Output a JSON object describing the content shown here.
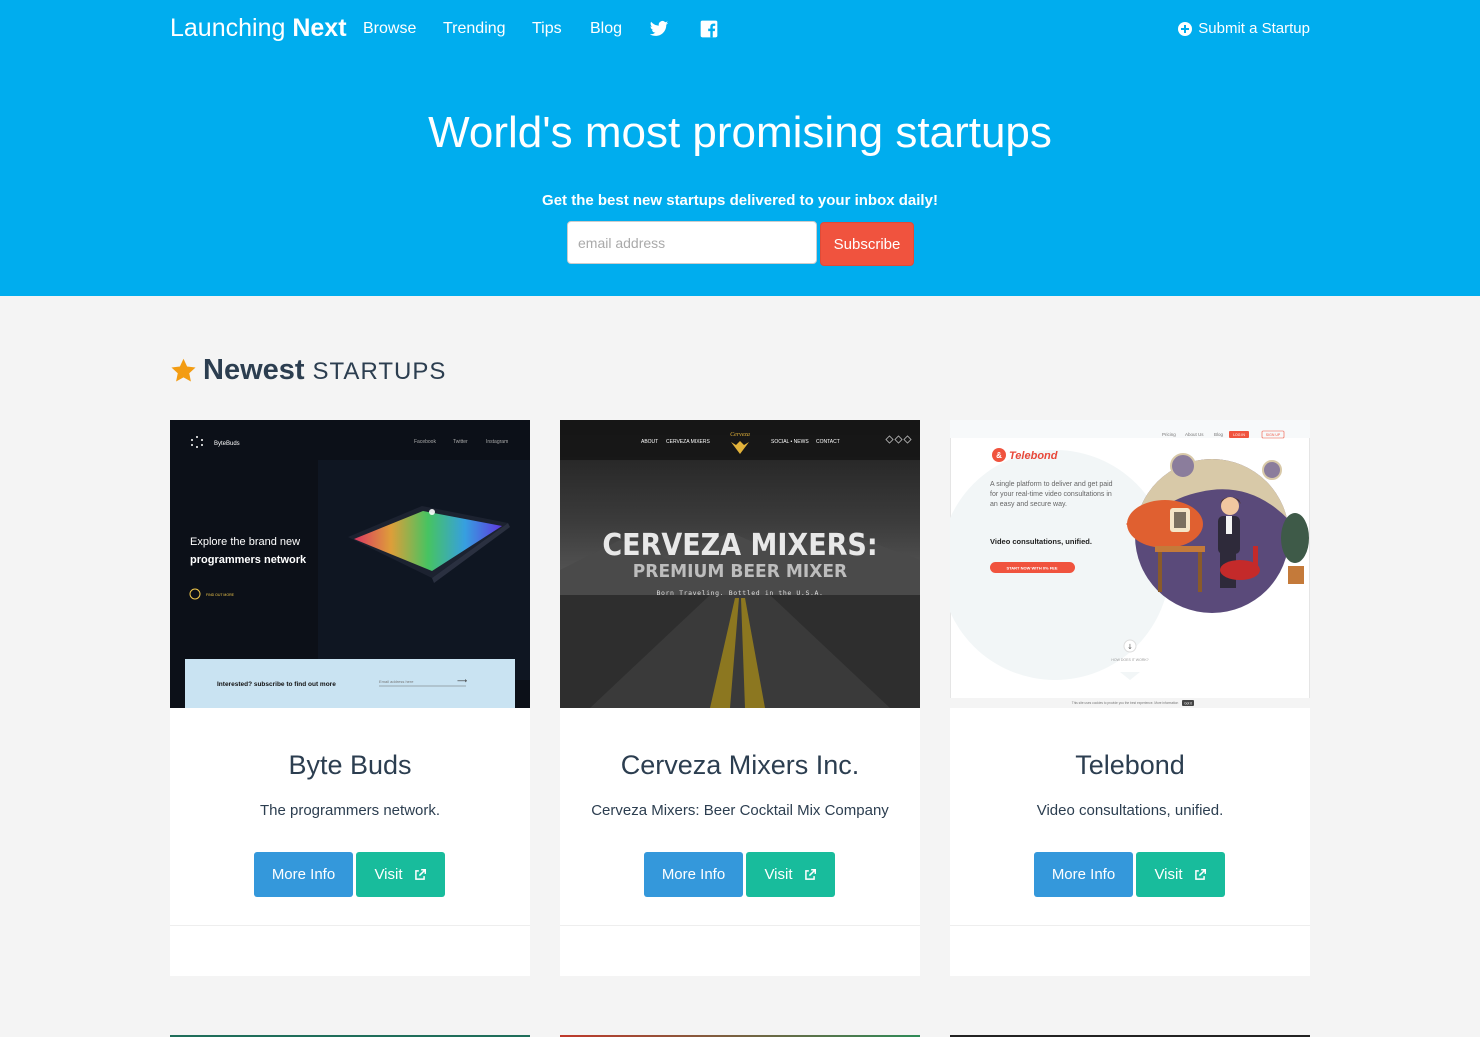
{
  "nav": {
    "brand_light": "Launching",
    "brand_bold": "Next",
    "links": [
      "Browse",
      "Trending",
      "Tips",
      "Blog"
    ],
    "icons": [
      "twitter-icon",
      "facebook-icon"
    ],
    "submit_label": "Submit a Startup"
  },
  "hero": {
    "title": "World's most promising startups",
    "subtitle": "Get the best new startups delivered to your inbox daily!",
    "email_placeholder": "email address",
    "subscribe_label": "Subscribe"
  },
  "section": {
    "strong": "Newest",
    "light": "STARTUPS"
  },
  "cards": [
    {
      "title": "Byte Buds",
      "description": "The programmers network.",
      "more_info": "More Info",
      "visit": "Visit",
      "shot": {
        "logo": "ByteBuds",
        "nav": [
          "Facebook",
          "Twitter",
          "Instagram"
        ],
        "line1": "Explore the brand new",
        "line2": "programmers network",
        "cta": "FIND OUT MORE",
        "banner": "Interested? subscribe to find out more",
        "banner_input": "Email address here"
      }
    },
    {
      "title": "Cerveza Mixers Inc.",
      "description": "Cerveza Mixers: Beer Cocktail Mix Company",
      "more_info": "More Info",
      "visit": "Visit",
      "shot": {
        "nav_left": [
          "ABOUT",
          "CERVEZA MIXERS"
        ],
        "nav_right": [
          "SOCIAL • NEWS",
          "CONTACT"
        ],
        "logo": "Cerveza",
        "headline": "CERVEZA MIXERS:",
        "subhead": "PREMIUM BEER MIXER",
        "tagline": "Born Traveling. Bottled in the U.S.A."
      }
    },
    {
      "title": "Telebond",
      "description": "Video consultations, unified.",
      "more_info": "More Info",
      "visit": "Visit",
      "shot": {
        "nav": [
          "Pricing",
          "About Us",
          "Blog"
        ],
        "login": "LOG IN",
        "signup": "SIGN UP",
        "logo": "Telebond",
        "body": "A single platform to deliver and get paid for your real-time video consultations in an easy and secure way.",
        "tagline": "Video consultations, unified.",
        "cta": "START NOW WITH 0% FEE",
        "how": "HOW DOES IT WORK?",
        "cookie": "This site uses cookies to provide you the best experience. More information",
        "cookie_btn": "Got it"
      }
    }
  ],
  "colors": {
    "header": "#00adee",
    "subscribe": "#f0533e",
    "more_info": "#3498db",
    "visit": "#18bc9c",
    "star": "#f39c12"
  }
}
